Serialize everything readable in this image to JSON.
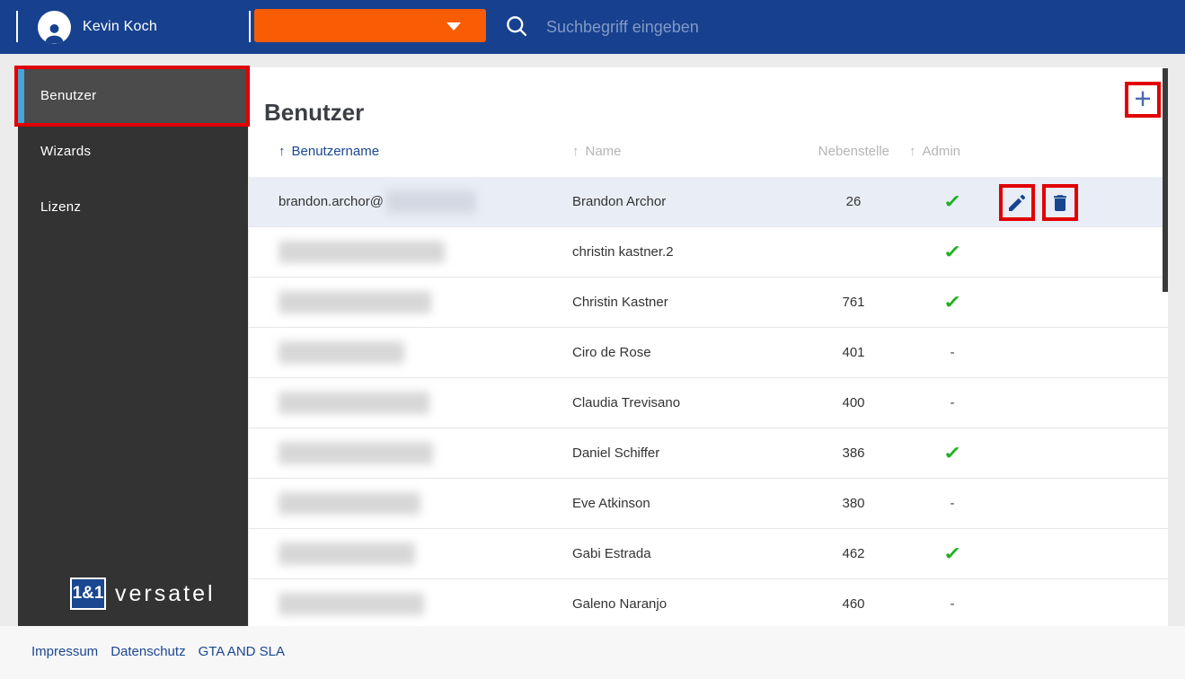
{
  "header": {
    "user_name": "Kevin Koch",
    "search_placeholder": "Suchbegriff eingeben"
  },
  "sidebar": {
    "items": [
      {
        "label": "Benutzer",
        "active": true
      },
      {
        "label": "Wizards",
        "active": false
      },
      {
        "label": "Lizenz",
        "active": false
      }
    ],
    "logo": {
      "box": "1&1",
      "text": "versatel"
    }
  },
  "main": {
    "title": "Benutzer",
    "add_button": "+",
    "table": {
      "columns": [
        {
          "label": "Benutzername",
          "arrow": "↑",
          "sorted": true
        },
        {
          "label": "Name",
          "arrow": "↑",
          "sorted": false
        },
        {
          "label": "Nebenstelle",
          "arrow": "",
          "sorted": false
        },
        {
          "label": "Admin",
          "arrow": "↑",
          "sorted": false
        }
      ],
      "rows": [
        {
          "username": "brandon.archor@",
          "redacted": true,
          "blur_width": 100,
          "name": "Brandon Archor",
          "extension": "26",
          "admin": "check",
          "highlighted": true,
          "actions": true
        },
        {
          "username": "",
          "redacted": true,
          "blur_width": 185,
          "name": "christin kastner.2",
          "extension": "",
          "admin": "check",
          "highlighted": false,
          "actions": false
        },
        {
          "username": "",
          "redacted": true,
          "blur_width": 170,
          "name": "Christin Kastner",
          "extension": "761",
          "admin": "check",
          "highlighted": false,
          "actions": false
        },
        {
          "username": "",
          "redacted": true,
          "blur_width": 140,
          "name": "Ciro de Rose",
          "extension": "401",
          "admin": "dash",
          "highlighted": false,
          "actions": false
        },
        {
          "username": "",
          "redacted": true,
          "blur_width": 168,
          "name": "Claudia Trevisano",
          "extension": "400",
          "admin": "dash",
          "highlighted": false,
          "actions": false
        },
        {
          "username": "",
          "redacted": true,
          "blur_width": 172,
          "name": "Daniel Schiffer",
          "extension": "386",
          "admin": "check",
          "highlighted": false,
          "actions": false
        },
        {
          "username": "",
          "redacted": true,
          "blur_width": 158,
          "name": "Eve Atkinson",
          "extension": "380",
          "admin": "dash",
          "highlighted": false,
          "actions": false
        },
        {
          "username": "",
          "redacted": true,
          "blur_width": 152,
          "name": "Gabi Estrada",
          "extension": "462",
          "admin": "check",
          "highlighted": false,
          "actions": false
        },
        {
          "username": "",
          "redacted": true,
          "blur_width": 162,
          "name": "Galeno Naranjo",
          "extension": "460",
          "admin": "dash",
          "highlighted": false,
          "actions": false
        }
      ]
    }
  },
  "footer": {
    "links": [
      "Impressum",
      "Datenschutz",
      "GTA AND SLA"
    ]
  },
  "icons": {
    "admin_yes": "✓",
    "admin_no": "-",
    "sort_arrow": "↑"
  },
  "colors": {
    "topbar_blue": "#17418f",
    "brand_orange": "#f85c05",
    "sidebar_dark": "#333333",
    "sidebar_active": "#4b4b4b",
    "sidebar_accent": "#4aa3d8",
    "link_blue": "#1b4791",
    "check_green": "#1fb11f",
    "row_highlight": "#e9edf6",
    "annotation_red": "#e10000"
  }
}
